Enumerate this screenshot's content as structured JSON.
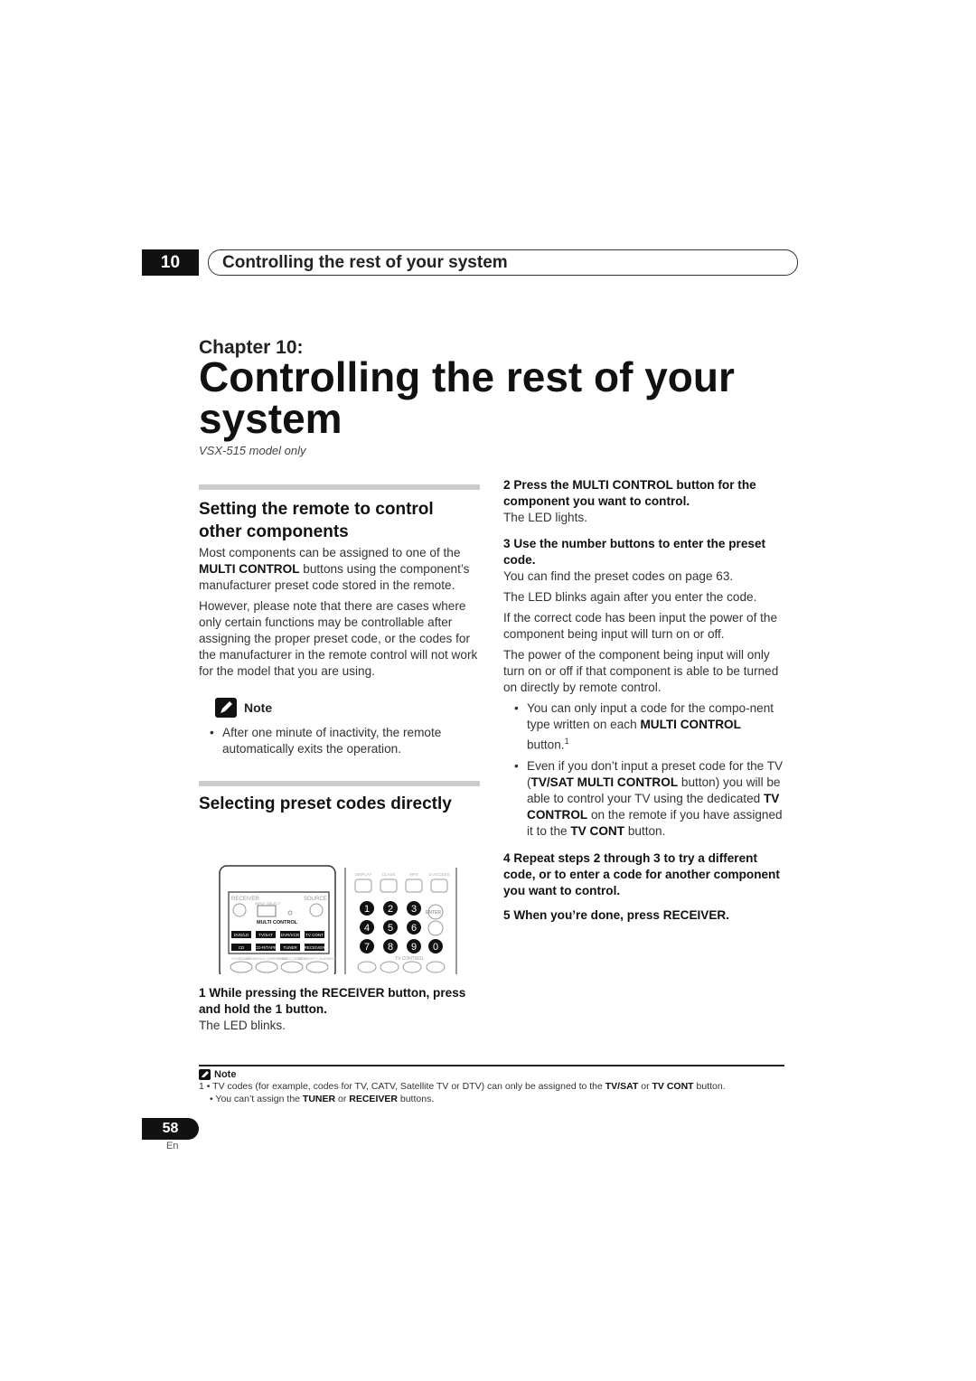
{
  "header": {
    "chapter_number": "10",
    "chapter_title": "Controlling the rest of your system"
  },
  "chapter_label": "Chapter 10:",
  "title": "Controlling the rest of your system",
  "subtitle": "VSX-515 model only",
  "section1": {
    "heading": "Setting the remote to control other components",
    "p1_a": "Most components can be assigned to one of the ",
    "p1_b": "MULTI CONTROL",
    "p1_c": " buttons using the component’s manufacturer preset code stored in the remote.",
    "p2": "However, please note that there are cases where only certain functions may be controllable after assigning the proper preset code, or the codes for the manufacturer in the remote control will not work for the model that you are using.",
    "note_label": "Note",
    "note_item": "After one minute of inactivity, the remote automatically exits the operation."
  },
  "section2": {
    "heading": "Selecting preset codes directly",
    "remote": {
      "receiver": "RECEIVER",
      "source": "SOURCE",
      "input_select": "INPUT SELECT",
      "multi_control": "MULTI CONTROL",
      "row1": [
        "DVD/LD",
        "TV/SAT",
        "DVR/VCR",
        "TV CONT"
      ],
      "row2": [
        "CD",
        "CD-R/TAPE",
        "TUNER",
        "RECEIVER"
      ],
      "bottom": [
        "STANDARD",
        "ADVANCED SURROUND",
        "STEREO DIRECT",
        "MIDNIGHT LOUDNESS"
      ],
      "top": [
        "DISPLAY",
        "CLASS",
        "MPX",
        "D.ACCESS"
      ],
      "digits": [
        "1",
        "2",
        "3",
        "4",
        "5",
        "6",
        "7",
        "8",
        "9",
        "0"
      ],
      "enter": "ENTER",
      "tv_control": "TV CONTROL"
    },
    "step1": "1   While pressing the RECEIVER button, press and hold the 1 button.",
    "step1_text": "The LED blinks."
  },
  "right": {
    "step2": "2   Press the MULTI CONTROL button for the component you want to control.",
    "step2_text": "The LED lights.",
    "step3": "3   Use the number buttons to enter the preset code.",
    "step3_t1": "You can find the preset codes on page 63.",
    "step3_t2": "The LED blinks again after you enter the code.",
    "step3_t3": "If the correct code has been input the power of the component being input will turn on or off.",
    "step3_t4": "The power of the component being input will only turn on or off if that component is able to be turned on directly by remote control.",
    "b1_a": "You can only input a code for the compo-nent type written on each ",
    "b1_b": "MULTI CONTROL",
    "b1_c": " button.",
    "b1_sup": "1",
    "b2_a": "Even if you don’t input a preset code for the TV (",
    "b2_b": "TV/SAT MULTI CONTROL",
    "b2_c": " button) you will be able to control your TV using the dedicated ",
    "b2_d": "TV CONTROL",
    "b2_e": " on the remote if you have assigned it to the ",
    "b2_f": "TV CONT",
    "b2_g": " button.",
    "step4": "4   Repeat steps 2 through 3 to try a different code, or to enter a code for another component you want to control.",
    "step5": "5   When you’re done, press RECEIVER."
  },
  "footnote": {
    "label": "Note",
    "n1_a": "1  •  TV codes (for example, codes for TV, CATV, Satellite TV or DTV) can only be assigned to the ",
    "n1_b": "TV/SAT",
    "n1_c": " or ",
    "n1_d": "TV CONT",
    "n1_e": " button.",
    "n2_a": "•  You can’t assign the ",
    "n2_b": "TUNER",
    "n2_c": " or ",
    "n2_d": "RECEIVER",
    "n2_e": " buttons."
  },
  "page_number": "58",
  "language": "En"
}
